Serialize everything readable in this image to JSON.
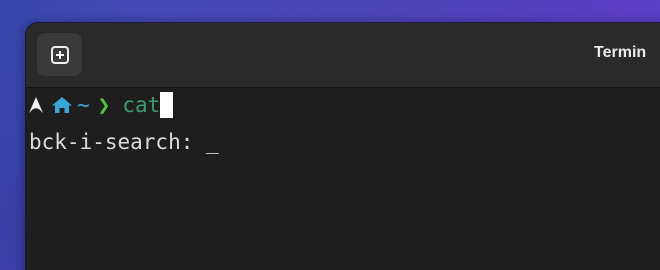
{
  "window": {
    "title": "Termin",
    "new_tab_icon": "plus-square-icon"
  },
  "prompt": {
    "os_icon": "arch-logo-icon",
    "home_icon": "home-icon",
    "cwd": "~",
    "prompt_symbol": "❯",
    "command": "cat",
    "colors": {
      "home": "#3aa6d8",
      "chevron": "#56c43c",
      "command": "#3a9d6e"
    }
  },
  "search": {
    "label": "bck-i-search: ",
    "cursor": "_"
  }
}
